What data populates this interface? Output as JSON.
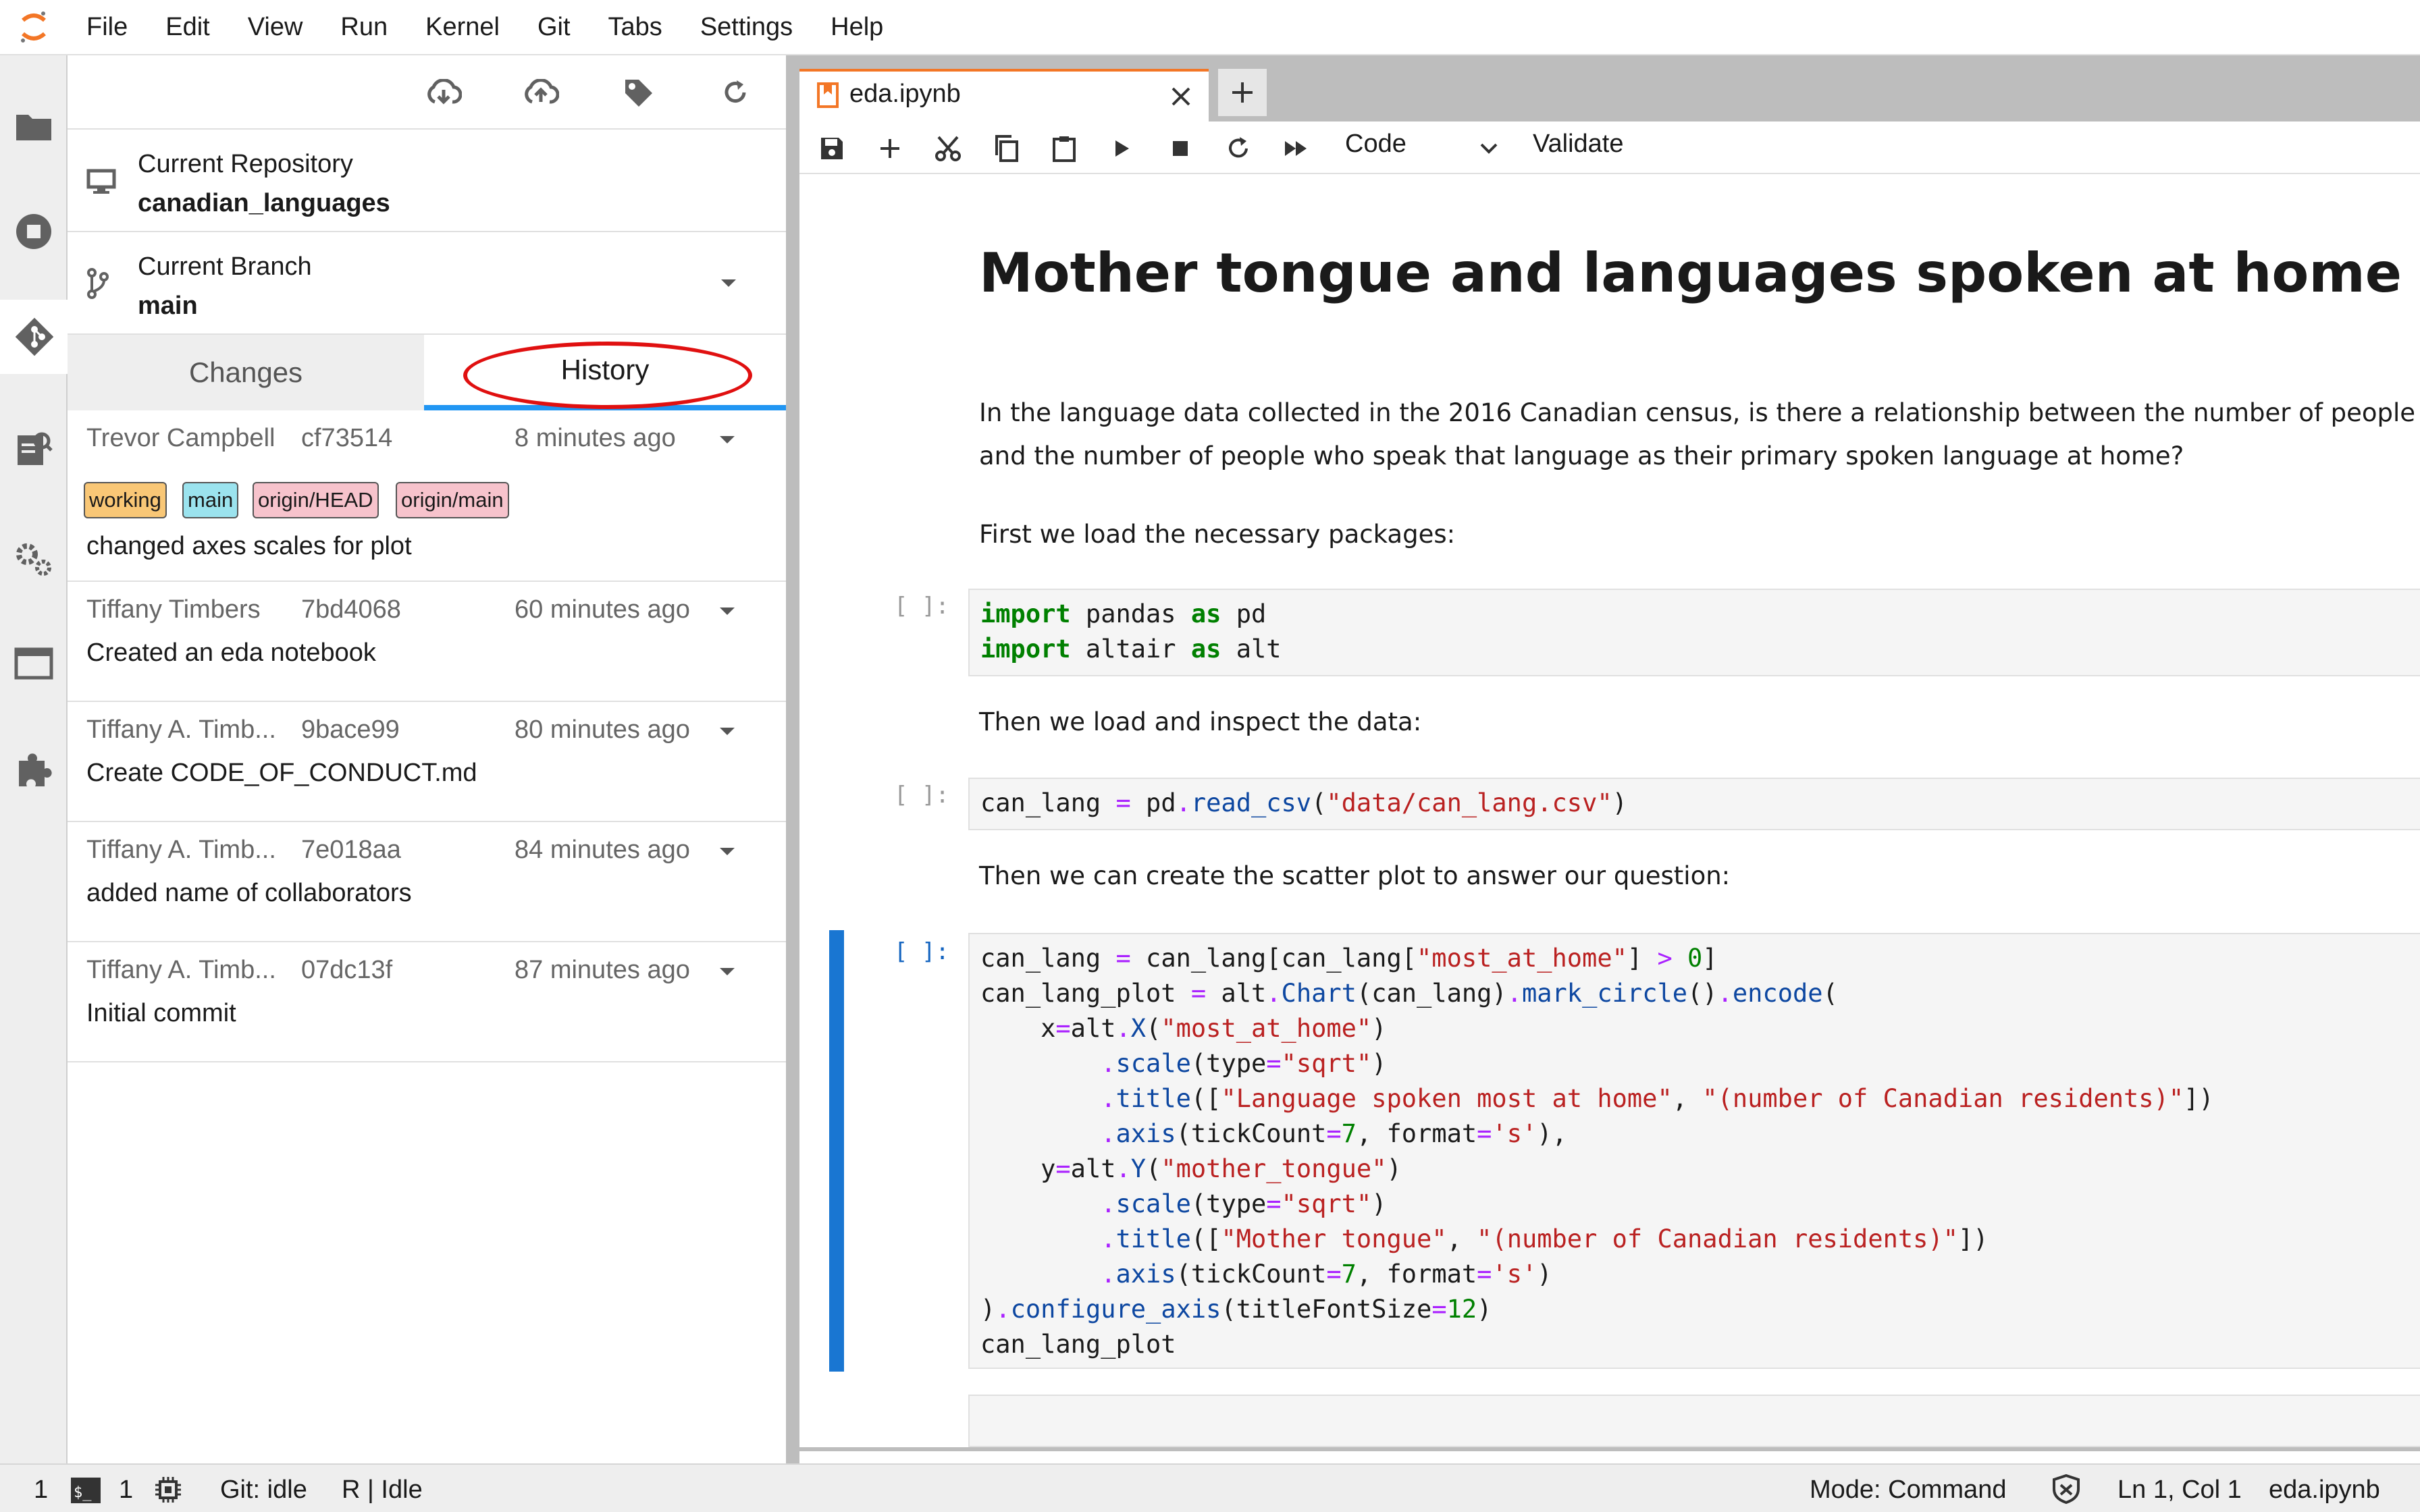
{
  "menubar": {
    "items": [
      "File",
      "Edit",
      "View",
      "Run",
      "Kernel",
      "Git",
      "Tabs",
      "Settings",
      "Help"
    ]
  },
  "activitybar": {
    "icons": [
      "folder-icon",
      "running-icon",
      "git-icon",
      "property-inspector-icon",
      "settings-icon",
      "tabs-icon",
      "extension-icon"
    ]
  },
  "git": {
    "repo_label": "Current Repository",
    "repo_name": "canadian_languages",
    "branch_label": "Current Branch",
    "branch_name": "main",
    "tabs": {
      "changes": "Changes",
      "history": "History"
    },
    "commits": [
      {
        "author": "Trevor Campbell",
        "sha": "cf73514",
        "time": "8 minutes ago",
        "message": "changed axes scales for plot",
        "tags": [
          {
            "label": "working",
            "color": "#f9c776"
          },
          {
            "label": "main",
            "color": "#9be3ee"
          },
          {
            "label": "origin/HEAD",
            "color": "#f7c3cc"
          },
          {
            "label": "origin/main",
            "color": "#f7c3cc"
          }
        ]
      },
      {
        "author": "Tiffany Timbers",
        "sha": "7bd4068",
        "time": "60 minutes ago",
        "message": "Created an eda notebook"
      },
      {
        "author": "Tiffany A. Timb...",
        "sha": "9bace99",
        "time": "80 minutes ago",
        "message": "Create CODE_OF_CONDUCT.md"
      },
      {
        "author": "Tiffany A. Timb...",
        "sha": "7e018aa",
        "time": "84 minutes ago",
        "message": "added name of collaborators"
      },
      {
        "author": "Tiffany A. Timb...",
        "sha": "07dc13f",
        "time": "87 minutes ago",
        "message": "Initial commit"
      }
    ]
  },
  "notebook": {
    "tab_name": "eda.ipynb",
    "cell_type": "Code",
    "validate_label": "Validate",
    "heading": "Mother tongue and languages spoken at home in Canad",
    "para1_line1": "In the language data collected in the 2016 Canadian census, is there a relationship between the number of people who",
    "para1_line2": "and the number of people who speak that language as their primary spoken language at home?",
    "para2": "First we load the necessary packages:",
    "para3": "Then we load and inspect the data:",
    "para4": "Then we can create the scatter plot to answer our question:",
    "prompt": "[ ]:"
  },
  "statusbar": {
    "terminals": "1",
    "kernels": "1",
    "git_status": "Git: idle",
    "kernel_status": "R | Idle",
    "mode": "Mode: Command",
    "cursor": "Ln 1, Col 1",
    "file": "eda.ipynb"
  },
  "colors": {
    "accent": "#2196f3",
    "tab_orange": "#f37626",
    "annotation_red": "#e01010",
    "active_cell": "#1976d2"
  }
}
